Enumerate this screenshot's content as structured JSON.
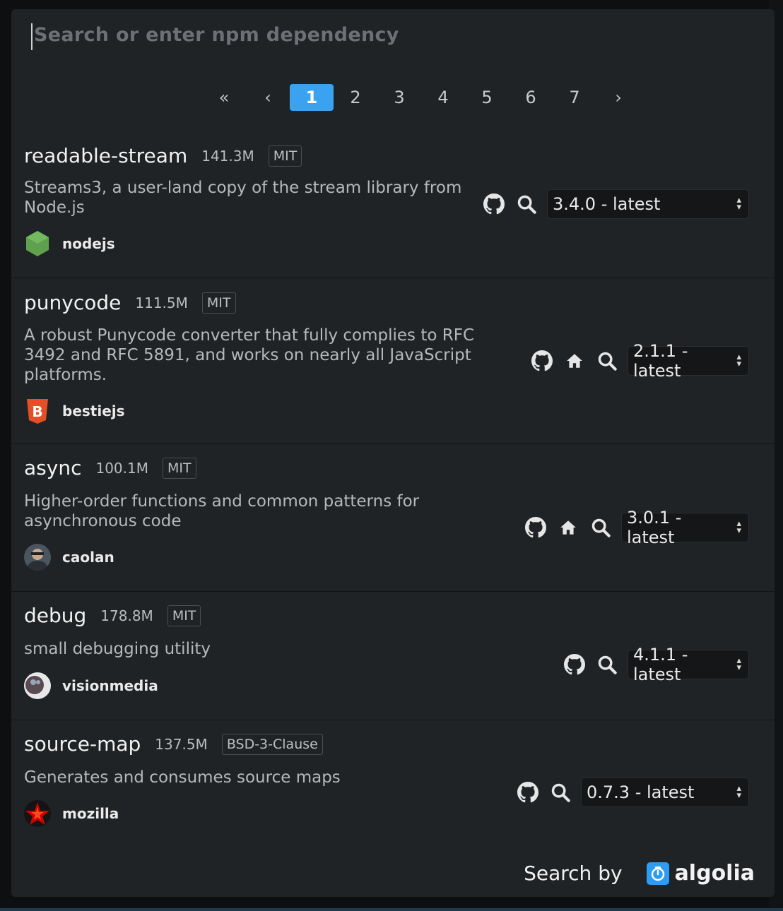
{
  "search": {
    "placeholder": "Search or enter npm dependency"
  },
  "pagination": {
    "first": "«",
    "prev": "‹",
    "next": "›",
    "pages": [
      "1",
      "2",
      "3",
      "4",
      "5",
      "6",
      "7"
    ],
    "active": "1"
  },
  "results": [
    {
      "name": "readable-stream",
      "downloads": "141.3M",
      "license": "MIT",
      "description": [
        "Streams3, a user-land copy of the stream library from",
        "Node.js"
      ],
      "owner": "nodejs",
      "version": "3.4.0 - latest",
      "icons": [
        "github-icon",
        "search-icon"
      ]
    },
    {
      "name": "punycode",
      "downloads": "111.5M",
      "license": "MIT",
      "description": [
        "A robust Punycode converter that fully complies to RFC",
        "3492 and RFC 5891, and works on nearly all JavaScript",
        "platforms."
      ],
      "owner": "bestiejs",
      "version": "2.1.1 - latest",
      "icons": [
        "github-icon",
        "home-icon",
        "search-icon"
      ]
    },
    {
      "name": "async",
      "downloads": "100.1M",
      "license": "MIT",
      "description": [
        "Higher-order functions and common patterns for",
        "asynchronous code"
      ],
      "owner": "caolan",
      "version": "3.0.1 - latest",
      "icons": [
        "github-icon",
        "home-icon",
        "search-icon"
      ]
    },
    {
      "name": "debug",
      "downloads": "178.8M",
      "license": "MIT",
      "description": [
        "small debugging utility"
      ],
      "owner": "visionmedia",
      "version": "4.1.1 - latest",
      "icons": [
        "github-icon",
        "search-icon"
      ]
    },
    {
      "name": "source-map",
      "downloads": "137.5M",
      "license": "BSD-3-Clause",
      "description": [
        "Generates and consumes source maps"
      ],
      "owner": "mozilla",
      "version": "0.7.3 - latest",
      "icons": [
        "github-icon",
        "search-icon"
      ]
    }
  ],
  "footer": {
    "search_by": "Search by",
    "brand": "algolia"
  },
  "colors": {
    "accent": "#3aa2ee",
    "modal_bg": "#202325",
    "algolia": "#2d9cf2"
  }
}
